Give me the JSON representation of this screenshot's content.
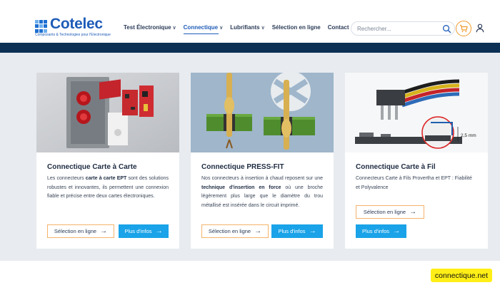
{
  "brand": {
    "name": "Cotelec",
    "tagline": "Composants & Technologies pour l'Electronique"
  },
  "nav": {
    "items": [
      {
        "label": "Test Électronique",
        "dropdown": true
      },
      {
        "label": "Connectique",
        "dropdown": true,
        "active": true
      },
      {
        "label": "Lubrifiants",
        "dropdown": true
      },
      {
        "label": "Sélection en ligne",
        "dropdown": false
      },
      {
        "label": "Contact",
        "dropdown": false
      }
    ]
  },
  "search": {
    "placeholder": "Rechercher..."
  },
  "colors": {
    "accent": "#1aa3e8",
    "brand": "#1e5cb8",
    "band": "#0d3155",
    "outline": "#f5b36a",
    "badge": "#ffef16"
  },
  "cards": [
    {
      "title": "Connectique Carte à Carte",
      "text_before": "Les connecteurs ",
      "text_bold": "carte à carte EPT",
      "text_after": " sont des solutions robustes et innovantes, ils permettent une connexion fiable et précise entre deux cartes électroniques.",
      "btn_online": "Sélection en ligne",
      "btn_info": "Plus d'infos"
    },
    {
      "title": "Connectique PRESS-FIT",
      "text_before": "Nos connecteurs à insertion à chaud reposent sur une ",
      "text_bold": "technique d'insertion en force",
      "text_after": " où une broche légèrement plus large que le diamètre du trou métallisé est insérée dans le circuit imprimé.",
      "btn_online": "Sélection en ligne",
      "btn_info": "Plus d'infos"
    },
    {
      "title": "Connectique Carte à Fil",
      "text": "Connecteurs Carte à Fils Provertha et EPT : Fiabilité et Polyvalence",
      "image_label": "2,5 mm",
      "btn_online": "Sélection en ligne",
      "btn_info": "Plus d'infos"
    }
  ],
  "domain_badge": "connectique.net"
}
